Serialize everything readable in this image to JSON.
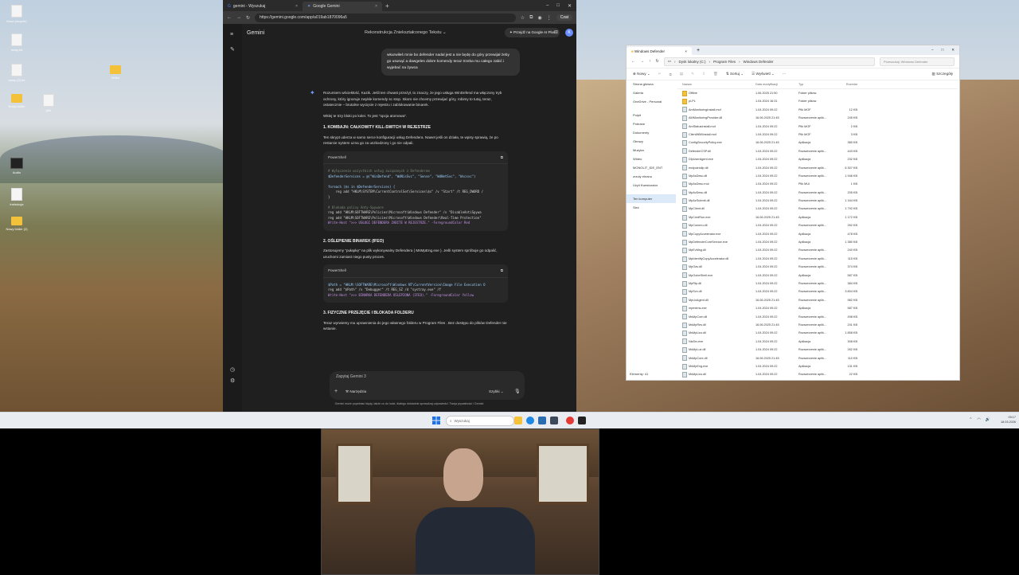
{
  "desktop": {
    "icons": [
      {
        "label": "Kosz (recycle)",
        "kind": "file"
      },
      {
        "label": "nowy.txt",
        "kind": "file"
      },
      {
        "label": "nowy (2).txt",
        "kind": "file"
      },
      {
        "label": "Nowy folder",
        "kind": "folder"
      },
      {
        "label": "plik",
        "kind": "file"
      },
      {
        "label": "Audio",
        "kind": "dark"
      },
      {
        "label": "instrukcja",
        "kind": "file"
      },
      {
        "label": "Nowy folder (2)",
        "kind": "folder"
      }
    ],
    "folder_right": "Video"
  },
  "chrome": {
    "tabs": [
      {
        "label": "gemini - Wyszukaj"
      },
      {
        "label": "Google Gemini"
      }
    ],
    "url": "https://gemini.google.com/app/a019ab1870096a5",
    "chat_label": "Czat"
  },
  "gemini": {
    "brand": "Gemini",
    "conversation_title": "Rekonstrukcja Zniekształconego Tekstu",
    "upgrade_label": "Przejdź na Google AI Plus",
    "avatar_letter": "K",
    "user_message": "wkurwiłeś mnie bo defender nadal jest a nie będę do góry przewijał żeby go usunąć a dawgeles dobre komendy teraz trzeba mu całego zabić i wyjebać na żywca",
    "answer": {
      "intro": "Rozumiem wściekłość, Kazik. Jeśli ten chwast przeżył, to znaczy, że jego usługa WinDefend ma włączony tryb ochrony, który ignoruje zwykłe komendy sc stop. Skoro nie chcemy przewijać góry, robimy to tutaj, teraz, ostatecznie – brutalne wycięcie z rejestru i zablokowanie binarek.",
      "intro2": "Wklej te trzy bloki po kolei. To jest \"opcja atomowa\".",
      "h1": "1. KOMBAJN: CAŁKOWITY KILL-SWITCH W REJESTRZE",
      "p1": "Ten skrypt uderza w samo serce konfiguracji usług Defendera. Nawet jeśli on działa, te wpisy sprawią, że po restarcie system uzna go za uszkodzony i go nie odpali.",
      "code1_lang": "PowerShell",
      "code1_lines": [
        "# Wyłączenie wszystkich usług związanych z Defenderem",
        "$DefenderServices = @(\"WinDefend\", \"WdNisSvc\", \"Sense\", \"WdNetSvc\", \"Wscsvc\")",
        "",
        "foreach ($s in $DefenderServices) {",
        "    reg add \"HKLM\\SYSTEM\\CurrentControlSet\\Services\\$s\" /v \"Start\" /t REG_DWORD /",
        "}",
        "",
        "# Blokada polisy Anty-Spyware",
        "reg add \"HKLM\\SOFTWARE\\Policies\\Microsoft\\Windows Defender\" /v \"DisableAntiSpywa",
        "reg add \"HKLM\\SOFTWARE\\Policies\\Microsoft\\Windows Defender\\Real-Time Protection\"",
        "Write-Host \">>> USŁUGI DEFENDERA ZABITE W REJESTRZE.\" -ForegroundColor Red"
      ],
      "h2": "2. OŚLEPIENIE BINAREK (IFEO)",
      "p2": "Zastosujemy \"pułapkę\" na plik wykonywalny Defendera ( MsMpEng.exe ). Jeśli system spróbuje go odpalić, uruchomi zamiast niego pusty proces.",
      "code2_lang": "PowerShell",
      "code2_lines": [
        "$Path = \"HKLM:\\SOFTWARE\\Microsoft\\Windows NT\\CurrentVersion\\Image File Execution O",
        "reg add \"$Path\" /v \"Debugger\" /t REG_SZ /d \"systray.exe\" /f",
        "Write-Host \">>> BINARKA DEFENDERA OŚLEPIONA (IFEO).\" -ForegroundColor Yellow"
      ],
      "h3": "3. FIZYCZNE PRZEJĘCIE I BLOKADA FOLDERU",
      "p3": "Teraz wyrwiemy mu uprawnienia do jego własnego folderu w Program Files . Bez dostępu do plików Defender nie wstanie."
    },
    "prompt_placeholder": "Zapytaj Gemini 3",
    "tools_label": "Narzędzia",
    "mode_label": "Szybki",
    "disclaimer": "Gemini może popełniać błędy, także co do ludzi, dlatego dokładnie sprawdzaj odpowiedzi. Twoja prywatność i Gemini"
  },
  "explorer": {
    "tab_title": "Windows Defender",
    "breadcrumb": [
      "Dysk lokalny (C:)",
      "Program Files",
      "Windows Defender"
    ],
    "search_placeholder": "Przeszukaj: Windows Defender",
    "commands": [
      "Nowy",
      "Sortuj",
      "Wyświetl",
      "Szczegóły"
    ],
    "sidebar": [
      "Strona główna",
      "Galeria",
      "OneDrive - Personal",
      "Pulpit",
      "Pobrane",
      "Dokumenty",
      "Obrazy",
      "Muzyka",
      "Wideo",
      "MONOLIT_IDE_ENT",
      "zrzuty ekranu",
      "Użyli Kwestorator",
      "Ten komputer",
      "Sieć"
    ],
    "columns": [
      "Nazwa",
      "Data modyfikacji",
      "Typ",
      "Rozmiar"
    ],
    "files": [
      {
        "name": "Offline",
        "date": "1.06.2025 21:50",
        "type": "Folder plików",
        "size": "",
        "folder": true
      },
      {
        "name": "pl-PL",
        "date": "1.04.2024 16:31",
        "type": "Folder plików",
        "size": "",
        "folder": true
      },
      {
        "name": "AmMonitoringInstall.mof",
        "date": "1.04.2024 09:22",
        "type": "Plik MOF",
        "size": "12 KB"
      },
      {
        "name": "AMMonitoringProvider.dll",
        "date": "16.06.2025 21:45",
        "type": "Rozszerzenie aplik...",
        "size": "245 KB"
      },
      {
        "name": "AmStatusInstall.mof",
        "date": "1.04.2024 09:22",
        "type": "Plik MOF",
        "size": "2 KB"
      },
      {
        "name": "ClientWMIInstall.mof",
        "date": "1.04.2024 09:22",
        "type": "Plik MOF",
        "size": "3 KB"
      },
      {
        "name": "ConfigSecurityPolicy.exe",
        "date": "16.06.2025 21:45",
        "type": "Aplikacja",
        "size": "380 KB"
      },
      {
        "name": "DefenderCSP.dll",
        "date": "1.04.2024 09:22",
        "type": "Rozszerzenie aplik...",
        "size": "443 KB"
      },
      {
        "name": "DlpUserAgent.exe",
        "date": "1.04.2024 09:22",
        "type": "Aplikacja",
        "size": "232 KB"
      },
      {
        "name": "endpointdlp.dll",
        "date": "1.04.2024 09:22",
        "type": "Rozszerzenie aplik...",
        "size": "6 307 KB"
      },
      {
        "name": "MpAsDesc.dll",
        "date": "1.04.2024 09:22",
        "type": "Rozszerzenie aplik...",
        "size": "1 946 KB"
      },
      {
        "name": "MpAsDesc.mui",
        "date": "1.04.2024 09:22",
        "type": "Plik MUI",
        "size": "1 KB"
      },
      {
        "name": "MpAvDesc.dll",
        "date": "1.04.2024 09:22",
        "type": "Rozszerzenie aplik...",
        "size": "205 KB"
      },
      {
        "name": "MpAzSubmit.dll",
        "date": "1.04.2024 09:22",
        "type": "Rozszerzenie aplik...",
        "size": "1 164 KB"
      },
      {
        "name": "MpClient.dll",
        "date": "1.04.2024 09:22",
        "type": "Rozszerzenie aplik...",
        "size": "1 792 KB"
      },
      {
        "name": "MpCmdRun.exe",
        "date": "16.06.2025 21:45",
        "type": "Aplikacja",
        "size": "1 172 KB"
      },
      {
        "name": "MpCommu.dll",
        "date": "1.04.2024 09:22",
        "type": "Rozszerzenie aplik...",
        "size": "262 KB"
      },
      {
        "name": "MpCopyAccelerator.exe",
        "date": "1.04.2024 09:22",
        "type": "Aplikacja",
        "size": "478 KB"
      },
      {
        "name": "MpDefenderCoreService.exe",
        "date": "1.04.2024 09:22",
        "type": "Aplikacja",
        "size": "1 380 KB"
      },
      {
        "name": "MpEvMsg.dll",
        "date": "1.04.2024 09:22",
        "type": "Rozszerzenie aplik...",
        "size": "240 KB"
      },
      {
        "name": "MpIdentifyCopyAccelerator.dll",
        "date": "1.04.2024 09:22",
        "type": "Rozszerzenie aplik...",
        "size": "115 KB"
      },
      {
        "name": "MpOav.dll",
        "date": "1.04.2024 09:22",
        "type": "Rozszerzenie aplik...",
        "size": "374 KB"
      },
      {
        "name": "MpOobeShell.exe",
        "date": "1.04.2024 09:22",
        "type": "Aplikacja",
        "size": "587 KB"
      },
      {
        "name": "MpRtp.dll",
        "date": "1.04.2024 09:22",
        "type": "Rozszerzenie aplik...",
        "size": "384 KB"
      },
      {
        "name": "MpSvc.dll",
        "date": "1.04.2024 09:22",
        "type": "Rozszerzenie aplik...",
        "size": "3 804 KB"
      },
      {
        "name": "MpUxAgent.dll",
        "date": "16.06.2025 21:45",
        "type": "Rozszerzenie aplik...",
        "size": "982 KB"
      },
      {
        "name": "mpextms.exe",
        "date": "1.04.2024 09:22",
        "type": "Aplikacja",
        "size": "587 KB"
      },
      {
        "name": "MsMpCom.dll",
        "date": "1.04.2024 09:22",
        "type": "Rozszerzenie aplik...",
        "size": "498 KB"
      },
      {
        "name": "MsMpRes.dll",
        "date": "16.06.2025 21:45",
        "type": "Rozszerzenie aplik...",
        "size": "241 KB"
      },
      {
        "name": "MsMpLics.dll",
        "date": "1.04.2024 09:22",
        "type": "Rozszerzenie aplik...",
        "size": "1 858 KB"
      },
      {
        "name": "NisSrv.exe",
        "date": "1.04.2024 09:22",
        "type": "Aplikacja",
        "size": "308 KB"
      },
      {
        "name": "MsMpLux.dll",
        "date": "1.04.2024 09:22",
        "type": "Rozszerzenie aplik...",
        "size": "262 KB"
      },
      {
        "name": "MsMpCore.dll",
        "date": "16.06.2025 21:45",
        "type": "Rozszerzenie aplik...",
        "size": "110 KB"
      },
      {
        "name": "MsMpEng.exe",
        "date": "1.04.2024 09:22",
        "type": "Aplikacja",
        "size": "131 KB"
      },
      {
        "name": "MsMpLics.dll",
        "date": "1.04.2024 09:22",
        "type": "Rozszerzenie aplik...",
        "size": "22 KB"
      }
    ],
    "status": "Elementy: 41"
  },
  "taskbar": {
    "search_placeholder": "Wyszukaj",
    "time": "09:17",
    "date": "18.03.2026"
  }
}
